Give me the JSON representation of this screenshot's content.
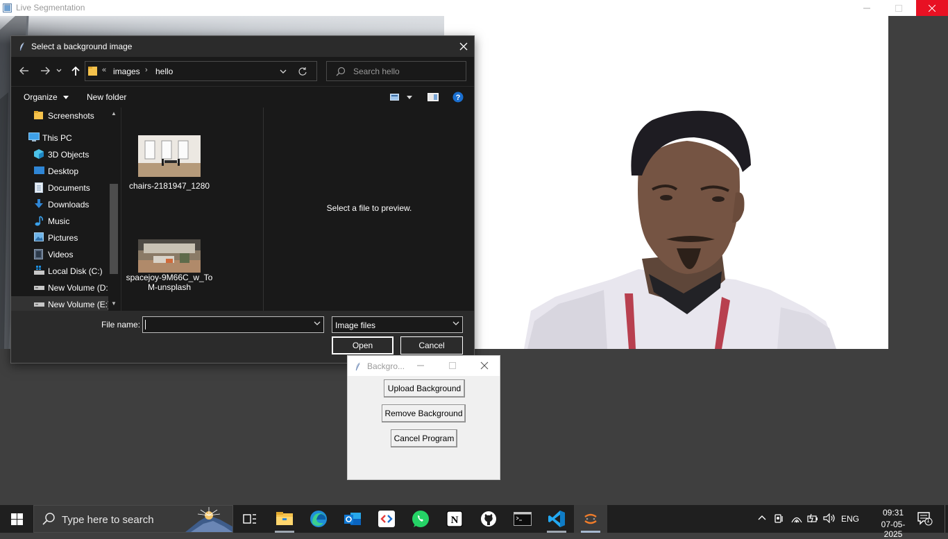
{
  "main_window": {
    "title": "Live Segmentation"
  },
  "file_dialog": {
    "title": "Select a background image",
    "breadcrumb": [
      "images",
      "hello"
    ],
    "breadcrumb_prefix": "«",
    "search_placeholder": "Search hello",
    "toolbar": {
      "organize": "Organize",
      "new_folder": "New folder"
    },
    "nav_items": [
      {
        "label": "Screenshots",
        "icon": "folder-icon"
      },
      {
        "label": "This PC",
        "icon": "computer-icon"
      },
      {
        "label": "3D Objects",
        "icon": "cube-icon"
      },
      {
        "label": "Desktop",
        "icon": "desktop-icon"
      },
      {
        "label": "Documents",
        "icon": "document-icon"
      },
      {
        "label": "Downloads",
        "icon": "download-icon"
      },
      {
        "label": "Music",
        "icon": "music-icon"
      },
      {
        "label": "Pictures",
        "icon": "pictures-icon"
      },
      {
        "label": "Videos",
        "icon": "videos-icon"
      },
      {
        "label": "Local Disk (C:)",
        "icon": "drive-icon"
      },
      {
        "label": "New Volume (D:",
        "icon": "drive-icon"
      },
      {
        "label": "New Volume (E:)",
        "icon": "drive-icon"
      }
    ],
    "files": [
      {
        "name": "chairs-2181947_1280"
      },
      {
        "name": "spacejoy-9M66C_w_ToM-unsplash"
      }
    ],
    "preview_text": "Select a file to preview.",
    "file_name_label": "File name:",
    "file_name_value": "",
    "file_type": "Image files",
    "open_label": "Open",
    "cancel_label": "Cancel"
  },
  "bg_window": {
    "title": "Backgro...",
    "upload_label": "Upload Background",
    "remove_label": "Remove Background",
    "cancel_label": "Cancel Program"
  },
  "taskbar": {
    "search_text": "Type here to search",
    "apps": [
      "task-view",
      "file-explorer",
      "edge",
      "outlook",
      "code-app",
      "whatsapp",
      "notion",
      "github",
      "terminal",
      "vscode",
      "tk-python"
    ],
    "language": "ENG",
    "time": "09:31",
    "date": "07-05-2025",
    "notification_count": "1"
  },
  "colors": {
    "dialog_bg": "#2b2b2b",
    "pane_bg": "#191919",
    "taskbar_bg": "#1f1f1f",
    "close_red": "#e81123",
    "accent_blue": "#0078d4"
  }
}
